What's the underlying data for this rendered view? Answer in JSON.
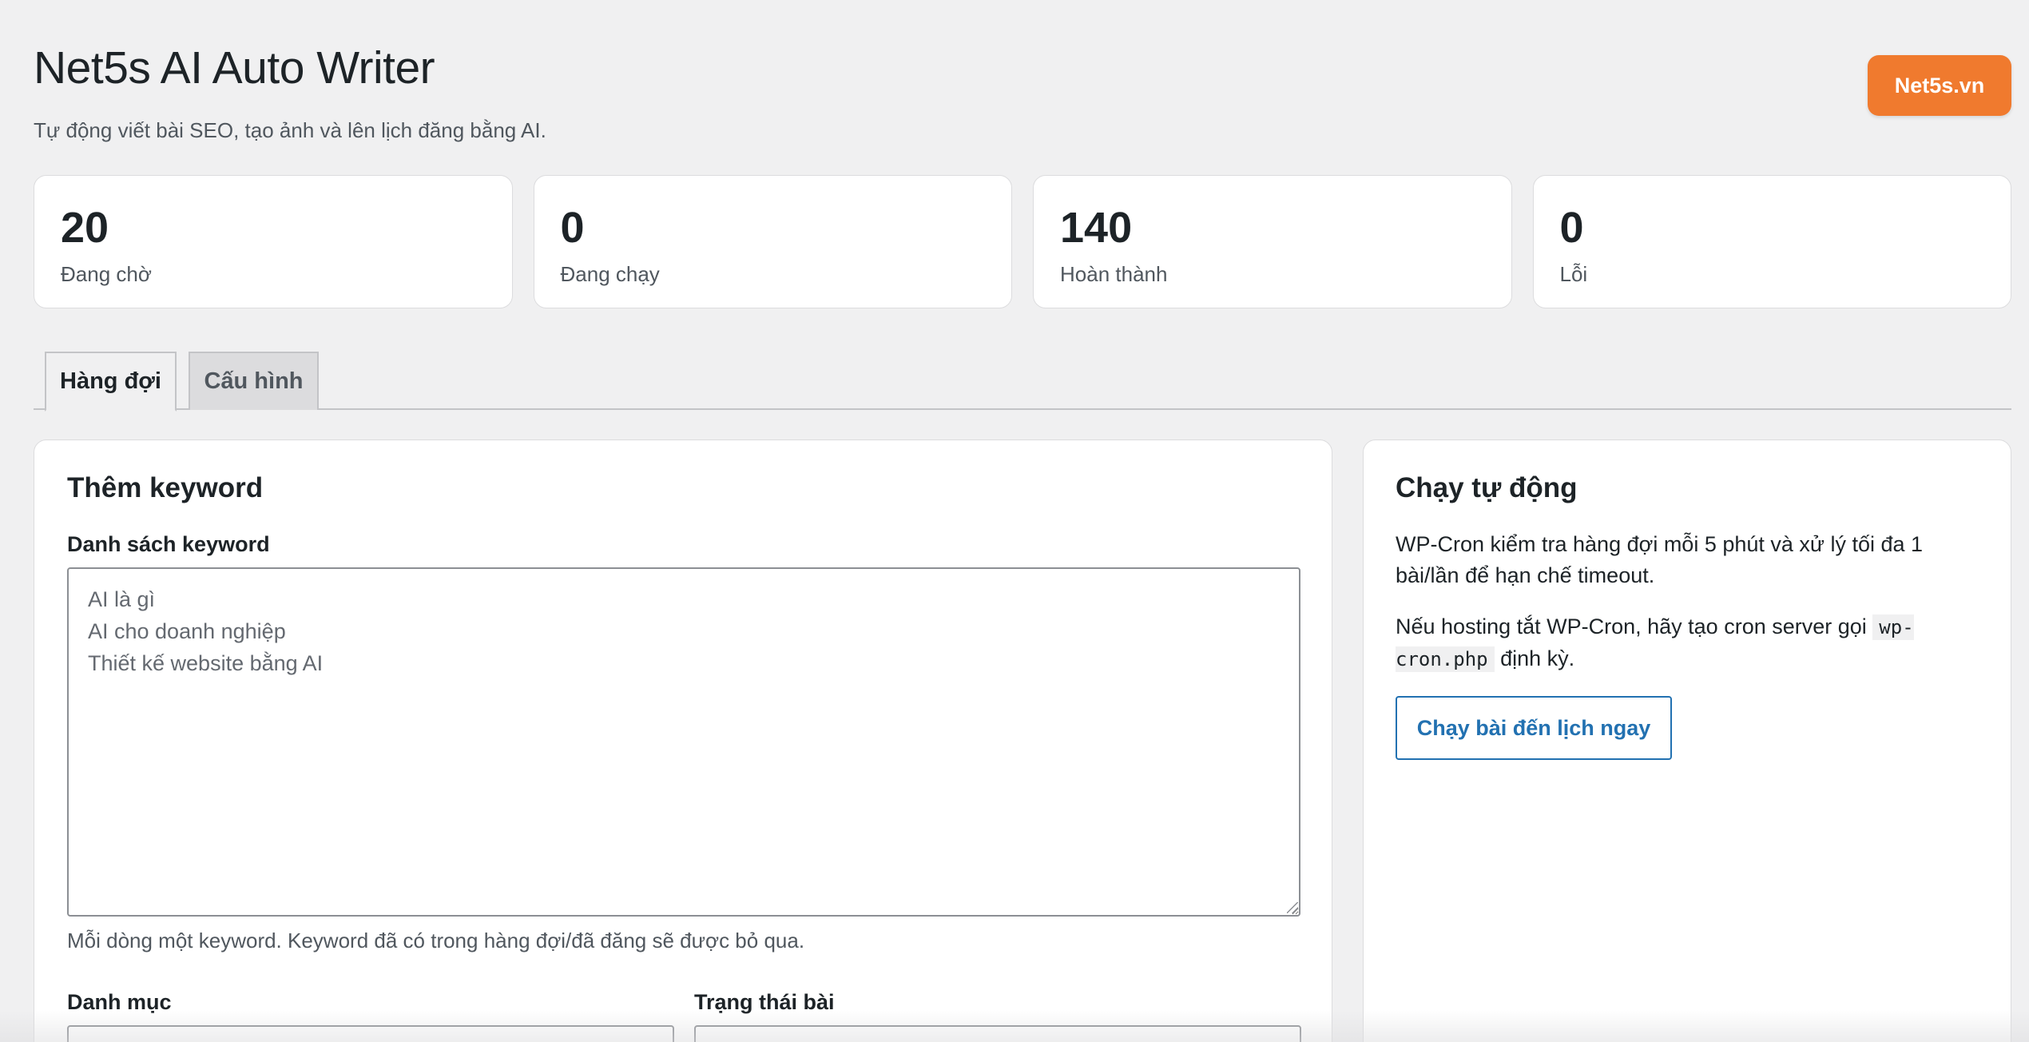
{
  "header": {
    "title": "Net5s AI Auto Writer",
    "subtitle": "Tự động viết bài SEO, tạo ảnh và lên lịch đăng bằng AI.",
    "brand_button": "Net5s.vn",
    "brand_color": "#f07a2e"
  },
  "stats": [
    {
      "value": "20",
      "label": "Đang chờ"
    },
    {
      "value": "0",
      "label": "Đang chạy"
    },
    {
      "value": "140",
      "label": "Hoàn thành"
    },
    {
      "value": "0",
      "label": "Lỗi"
    }
  ],
  "tabs": [
    {
      "label": "Hàng đợi",
      "active": true
    },
    {
      "label": "Cấu hình",
      "active": false
    }
  ],
  "add_keyword": {
    "title": "Thêm keyword",
    "list_label": "Danh sách keyword",
    "textarea_placeholder": "AI là gì\nAI cho doanh nghiệp\nThiết kế website bằng AI",
    "help": "Mỗi dòng một keyword. Keyword đã có trong hàng đợi/đã đăng sẽ được bỏ qua.",
    "category_label": "Danh mục",
    "status_label": "Trạng thái bài"
  },
  "auto_run": {
    "title": "Chạy tự động",
    "description": "WP-Cron kiểm tra hàng đợi mỗi 5 phút và xử lý tối đa 1 bài/lần để hạn chế timeout.",
    "cron_prefix": "Nếu hosting tắt WP-Cron, hãy tạo cron server gọi",
    "cron_code": "wp-cron.php",
    "cron_suffix": "định kỳ.",
    "run_button": "Chạy bài đến lịch ngay",
    "accent_color": "#2271b1"
  }
}
